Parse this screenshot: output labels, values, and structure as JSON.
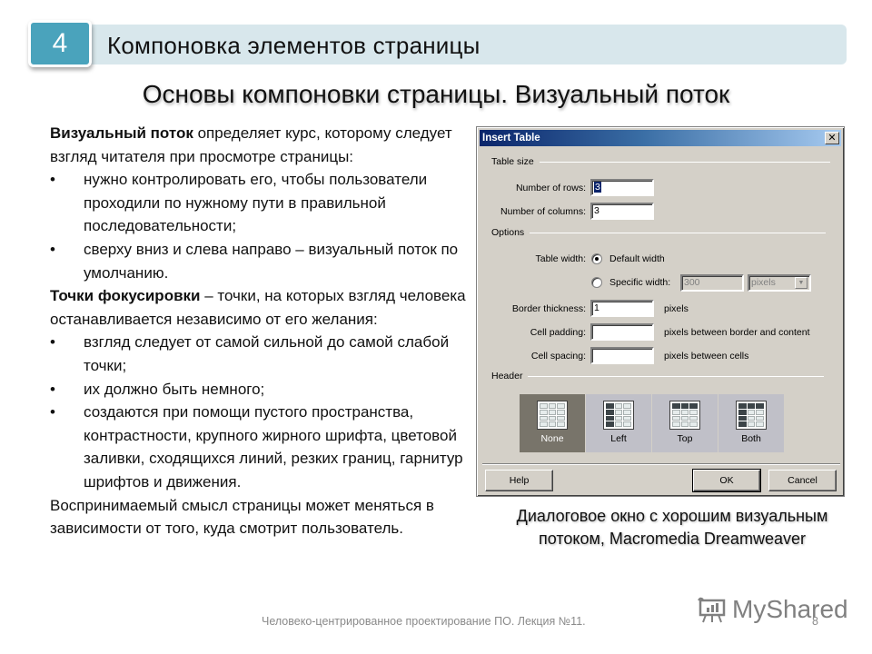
{
  "header": {
    "section_number": "4",
    "title": "Компоновка элементов страницы"
  },
  "subtitle": "Основы компоновки страницы. Визуальный поток",
  "body": {
    "p1_bold": "Визуальный поток",
    "p1_rest": " определяет курс, которому следует взгляд читателя при просмотре страницы:",
    "bullets1": [
      "нужно контролировать его, чтобы пользователи проходили по нужному пути в правильной последовательности;",
      "сверху вниз и слева направо – визуальный поток по умолчанию."
    ],
    "p2_bold": "Точки фокусировки",
    "p2_rest": " – точки, на которых взгляд человека останавливается независимо от его желания:",
    "bullets2": [
      "взгляд следует от самой сильной до самой слабой точки;",
      "их должно быть немного;",
      "создаются при помощи пустого пространства, контрастности, крупного жирного шрифта, цветовой заливки, сходящихся линий, резких границ, гарнитур шрифтов и движения."
    ],
    "p3": "Воспринимаемый смысл страницы может меняться в зависимости от того, куда смотрит пользователь.",
    "bullet_char": "•"
  },
  "dialog": {
    "title": "Insert Table",
    "close_glyph": "✕",
    "table_size_label": "Table size",
    "rows_label": "Number of rows:",
    "rows_value": "3",
    "cols_label": "Number of columns:",
    "cols_value": "3",
    "options_label": "Options",
    "table_width_label": "Table width:",
    "default_width_label": "Default width",
    "specific_width_label": "Specific width:",
    "specific_width_value": "300",
    "units_value": "pixels",
    "dropdown_glyph": "▼",
    "border_label": "Border thickness:",
    "border_value": "1",
    "border_unit": "pixels",
    "padding_label": "Cell padding:",
    "padding_value": "",
    "padding_unit": "pixels between border and content",
    "spacing_label": "Cell spacing:",
    "spacing_value": "",
    "spacing_unit": "pixels between cells",
    "header_label": "Header",
    "header_options": [
      "None",
      "Left",
      "Top",
      "Both"
    ],
    "header_selected": "None",
    "help_label": "Help",
    "ok_label": "OK",
    "cancel_label": "Cancel"
  },
  "caption": "Диалоговое окно с хорошим визуальным потоком, Macromedia Dreamweaver",
  "footer": {
    "text": "Человеко-центрированное проектирование ПО. Лекция №11.",
    "page_number": "8",
    "watermark": "MyShared"
  },
  "colors": {
    "badge": "#4aa3bc",
    "header_bar": "#d8e7ec",
    "dialog_bg": "#d4d0c8",
    "titlebar_start": "#0a246a",
    "titlebar_end": "#a6caf0",
    "header_selected": "#78746a"
  }
}
